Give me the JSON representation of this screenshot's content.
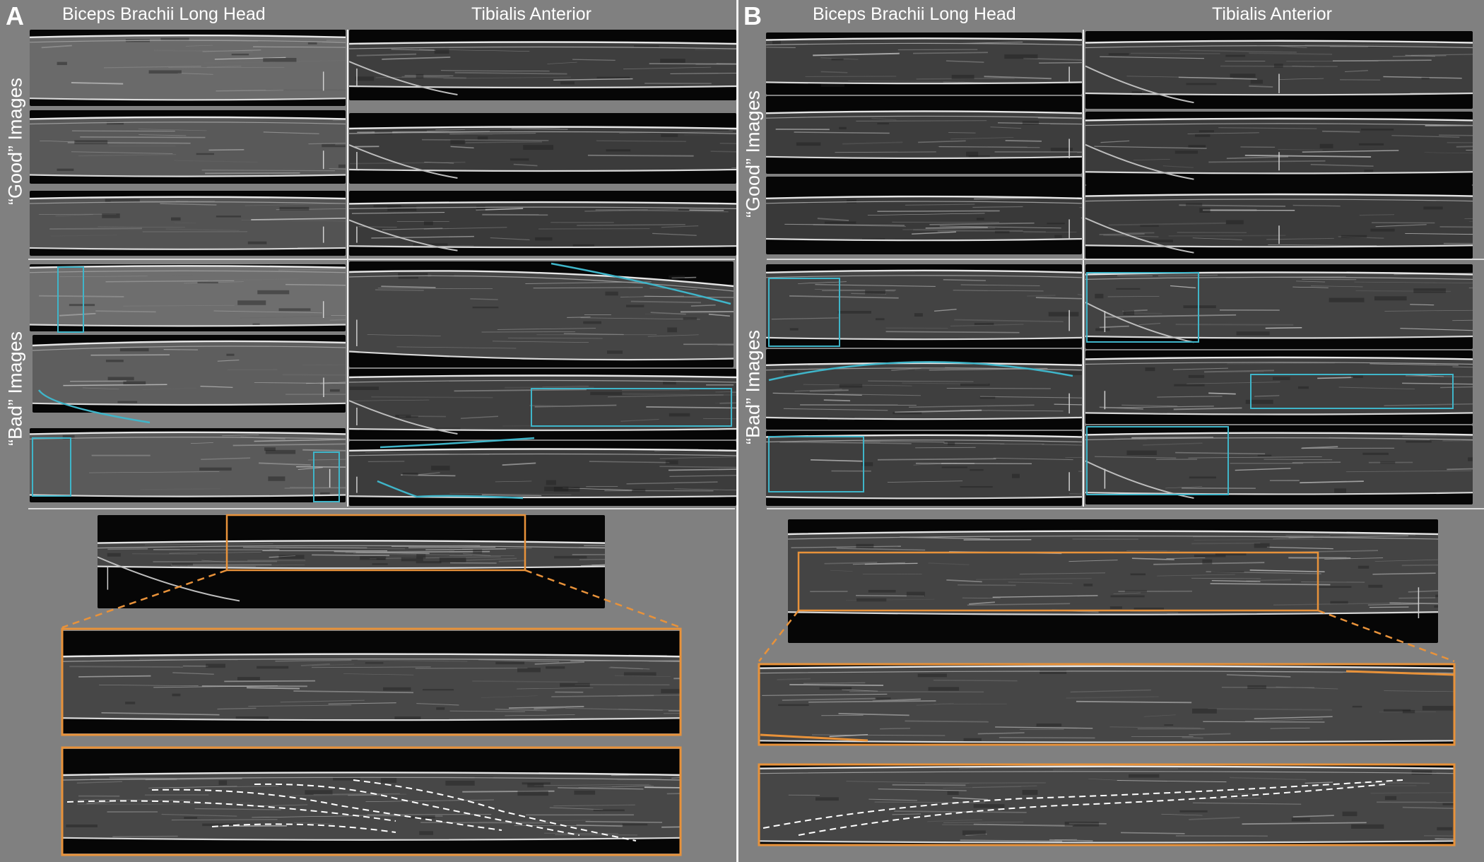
{
  "figure": {
    "panels": [
      {
        "id": "A",
        "letter": "A",
        "columns": [
          "Biceps Brachii Long Head",
          "Tibialis Anterior"
        ],
        "row_labels": [
          "“Good” Images",
          "“Bad” Images"
        ]
      },
      {
        "id": "B",
        "letter": "B",
        "columns": [
          "Biceps Brachii Long Head",
          "Tibialis Anterior"
        ],
        "row_labels": [
          "“Good” Images",
          "“Bad” Images"
        ]
      }
    ],
    "colors": {
      "background": "#808080",
      "annotation_cyan": "#3fb5c9",
      "annotation_orange": "#e8923a",
      "fascicle_dashes": "#ffffff",
      "ultrasound_dark": "#0c0c0c"
    }
  }
}
